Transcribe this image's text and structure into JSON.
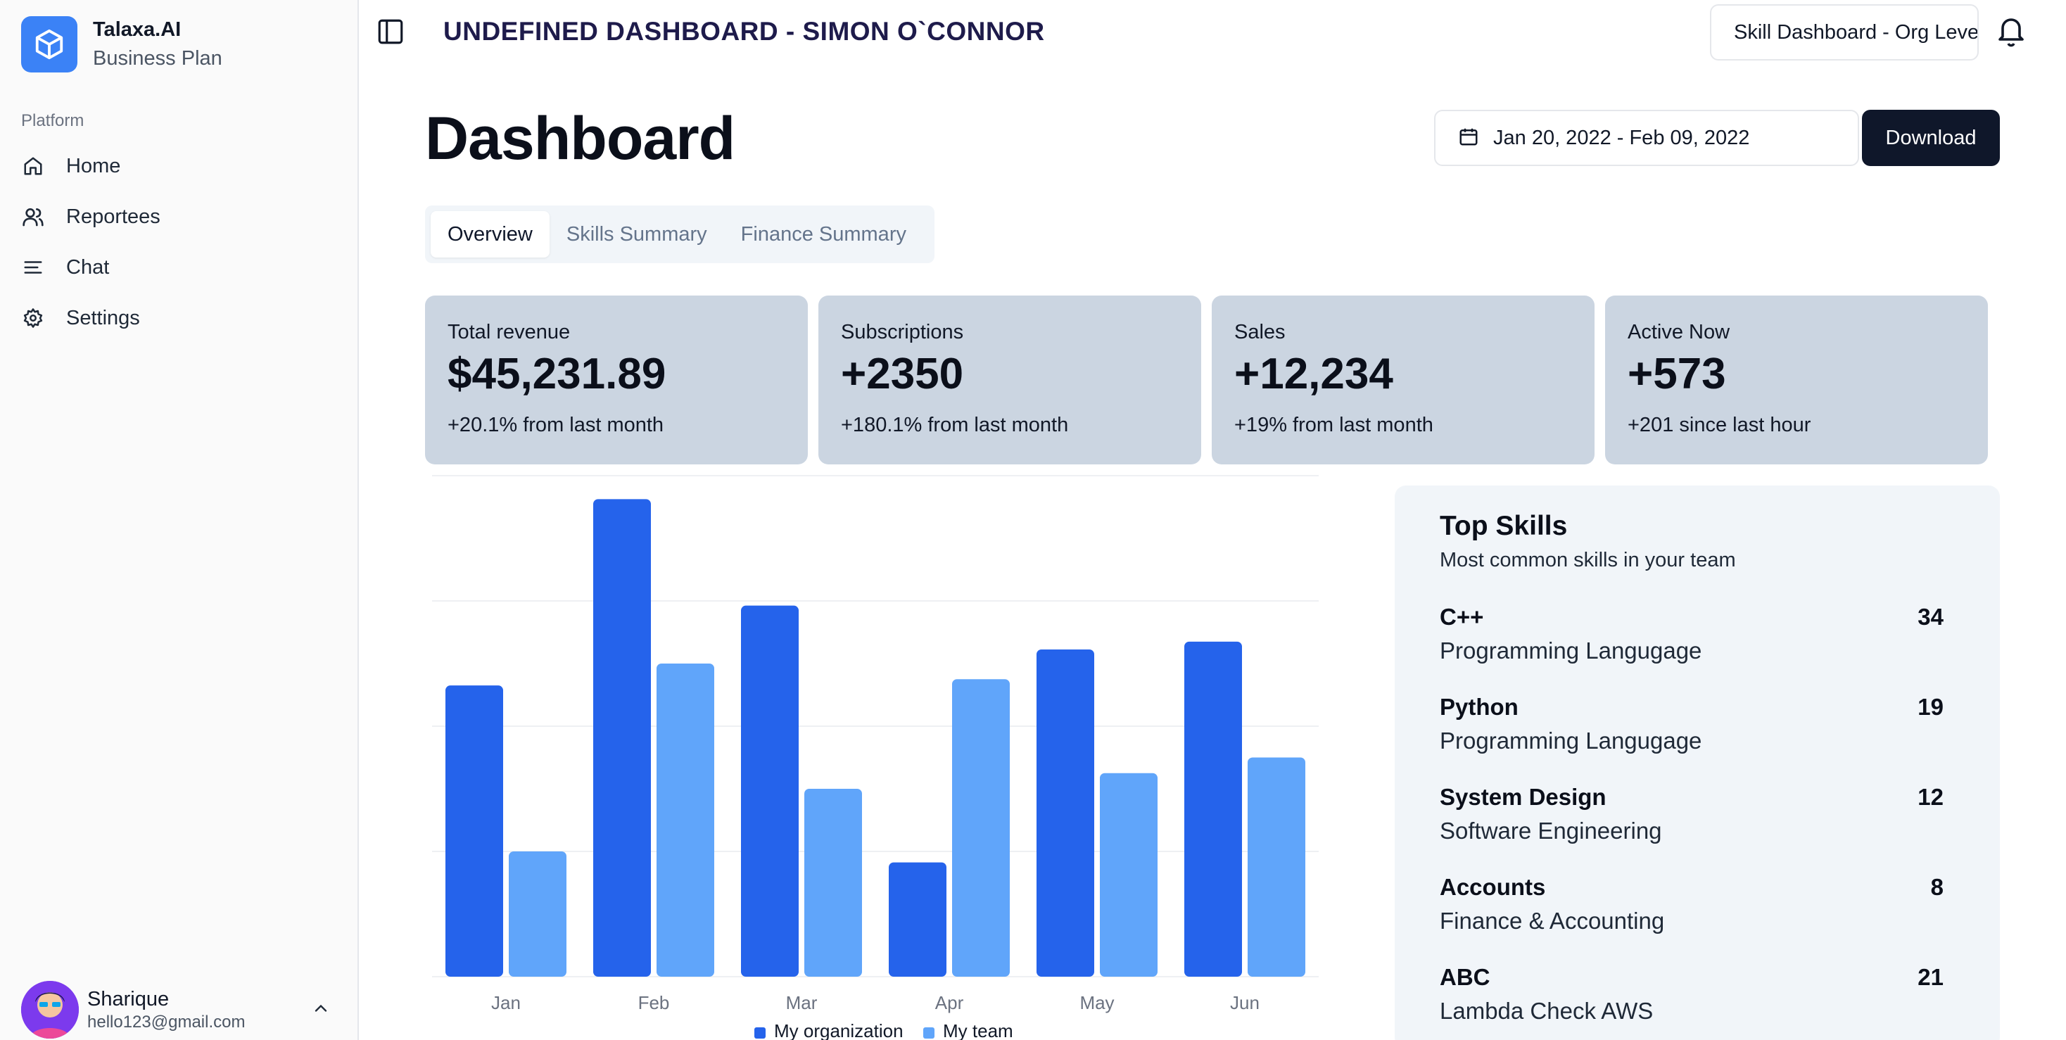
{
  "sidebar": {
    "brand": {
      "name": "Talaxa.AI",
      "plan": "Business Plan"
    },
    "section_label": "Platform",
    "items": [
      {
        "label": "Home",
        "icon": "home-icon"
      },
      {
        "label": "Reportees",
        "icon": "users-icon"
      },
      {
        "label": "Chat",
        "icon": "menu-lines-icon"
      },
      {
        "label": "Settings",
        "icon": "gear-icon"
      }
    ],
    "user": {
      "name": "Sharique",
      "email": "hello123@gmail.com"
    }
  },
  "header": {
    "title": "UNDEFINED DASHBOARD - SIMON O`CONNOR",
    "dashboard_select": "Skill Dashboard - Org Level"
  },
  "page": {
    "title": "Dashboard",
    "date_range": "Jan 20, 2022 - Feb 09, 2022",
    "download_label": "Download",
    "tabs": [
      "Overview",
      "Skills Summary",
      "Finance Summary"
    ],
    "active_tab": "Overview"
  },
  "stats": [
    {
      "label": "Total revenue",
      "value": "$45,231.89",
      "sub": "+20.1% from last month"
    },
    {
      "label": "Subscriptions",
      "value": "+2350",
      "sub": "+180.1% from last month"
    },
    {
      "label": "Sales",
      "value": "+12,234",
      "sub": "+19% from last month"
    },
    {
      "label": "Active Now",
      "value": "+573",
      "sub": "+201 since last hour"
    }
  ],
  "chart_data": {
    "type": "bar",
    "categories": [
      "Jan",
      "Feb",
      "Mar",
      "Apr",
      "May",
      "Jun"
    ],
    "series": [
      {
        "name": "My organization",
        "color": "#2563eb",
        "values": [
          186,
          305,
          237,
          73,
          209,
          214
        ]
      },
      {
        "name": "My team",
        "color": "#60a5fa",
        "values": [
          80,
          200,
          120,
          190,
          130,
          140
        ]
      }
    ],
    "ylim": [
      0,
      320
    ],
    "grid": true,
    "legend": "bottom"
  },
  "top_skills": {
    "title": "Top Skills",
    "subtitle": "Most common skills in your team",
    "items": [
      {
        "name": "C++",
        "category": "Programming Langugage",
        "count": "34"
      },
      {
        "name": "Python",
        "category": "Programming Langugage",
        "count": "19"
      },
      {
        "name": "System Design",
        "category": "Software Engineering",
        "count": "12"
      },
      {
        "name": "Accounts",
        "category": "Finance & Accounting",
        "count": "8"
      },
      {
        "name": "ABC",
        "category": "Lambda Check AWS",
        "count": "21"
      }
    ]
  }
}
